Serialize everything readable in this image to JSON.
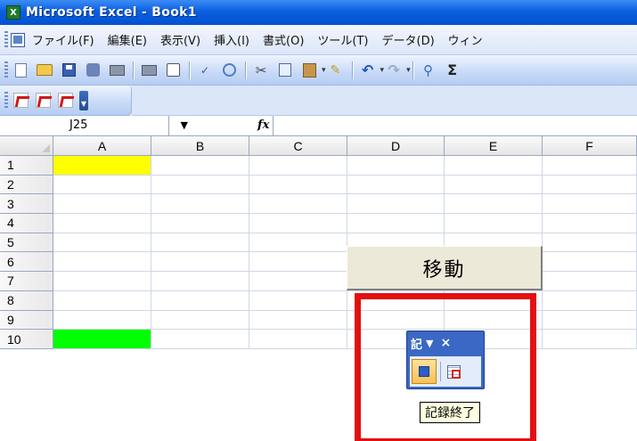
{
  "window": {
    "title": "Microsoft Excel - Book1",
    "app_icon_letter": "X"
  },
  "menu": {
    "items": [
      "ファイル(F)",
      "編集(E)",
      "表示(V)",
      "挿入(I)",
      "書式(O)",
      "ツール(T)",
      "データ(D)",
      "ウィン"
    ]
  },
  "toolbar": {
    "icons": [
      "new-icon",
      "open-icon",
      "save-icon",
      "permission-icon",
      "print-icon",
      "print-preview-icon",
      "spelling-icon",
      "research-icon",
      "cut-icon",
      "copy-icon",
      "paste-icon",
      "format-painter-icon",
      "undo-icon",
      "redo-icon",
      "hyperlink-icon",
      "autosum-icon"
    ]
  },
  "pdf_toolbar": {
    "icons": [
      "pdf-convert-icon",
      "pdf-convert-send-icon",
      "pdf-review-icon"
    ]
  },
  "formula_bar": {
    "name_box": "J25",
    "fx_label": "fx",
    "formula": ""
  },
  "sheet": {
    "columns": [
      "A",
      "B",
      "C",
      "D",
      "E",
      "F"
    ],
    "rows": [
      "1",
      "2",
      "3",
      "4",
      "5",
      "6",
      "7",
      "8",
      "9",
      "10"
    ],
    "cell_colors": {
      "A1": "#ffff00",
      "A10": "#00ff00"
    }
  },
  "sheet_button": {
    "label": "移動"
  },
  "macro_toolbar": {
    "title": "記",
    "dropdown": "▼",
    "close": "×"
  },
  "tooltip": {
    "text": "記録終了"
  },
  "highlight": {
    "color": "#e21010"
  }
}
